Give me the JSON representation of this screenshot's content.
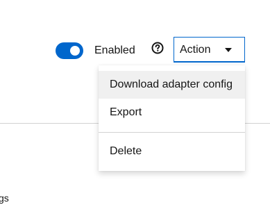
{
  "toolbar": {
    "toggle_state": "on",
    "enabled_label": "Enabled",
    "help_icon": "question-circle-icon",
    "action_label": "Action",
    "caret_icon": "caret-down-icon"
  },
  "menu": {
    "items": [
      {
        "label": "Download adapter config",
        "highlighted": true
      },
      {
        "label": "Export",
        "highlighted": false
      },
      {
        "label": "Delete",
        "highlighted": false
      }
    ]
  },
  "background": {
    "partial_text": "gs"
  },
  "colors": {
    "accent": "#0066cc",
    "menu_hover": "#f0f0f0",
    "divider": "#d2d2d2",
    "text": "#151515"
  }
}
